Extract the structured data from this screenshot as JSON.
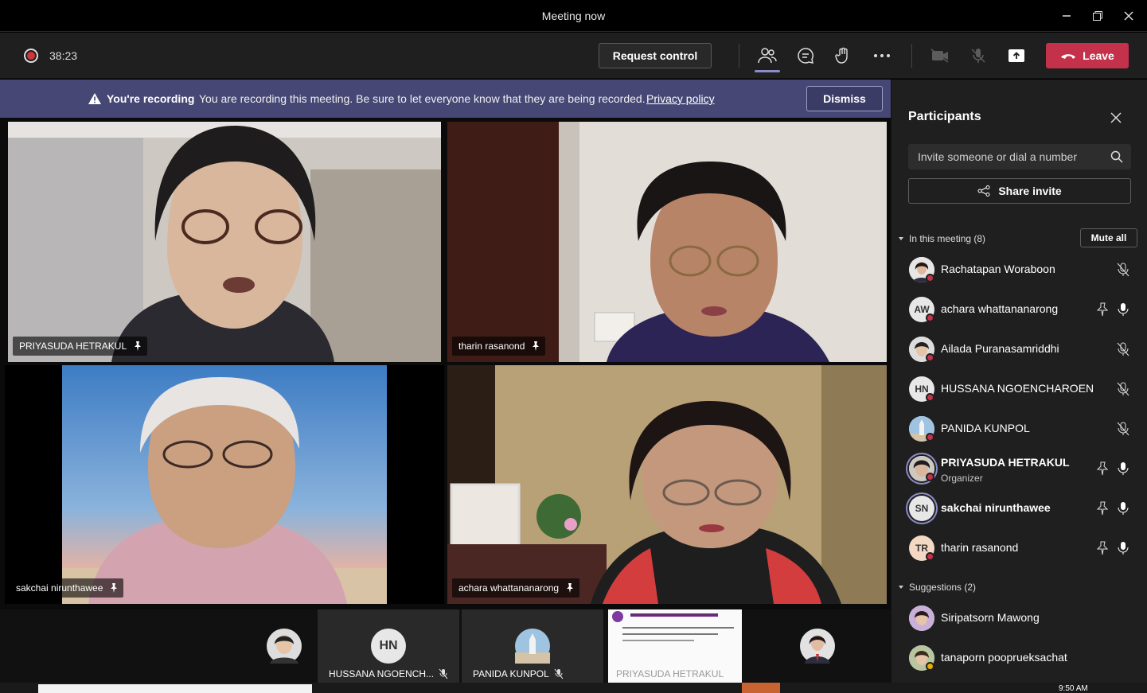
{
  "window": {
    "title": "Meeting now",
    "minimize": "—",
    "restore": "❐",
    "close": "✕"
  },
  "toolbar": {
    "timer": "38:23",
    "request_control": "Request control",
    "leave": "Leave"
  },
  "banner": {
    "title": "You're recording",
    "message": "You are recording this meeting. Be sure to let everyone know that they are being recorded.",
    "link": "Privacy policy",
    "dismiss": "Dismiss"
  },
  "stage": {
    "tiles": [
      {
        "name": "PRIYASUDA HETRAKUL"
      },
      {
        "name": "tharin rasanond"
      },
      {
        "name": "sakchai nirunthawee"
      },
      {
        "name": "achara whattananarong"
      }
    ],
    "bottom": [
      {
        "name": ""
      },
      {
        "initials": "HN",
        "name": "HUSSANA NGOENCH..."
      },
      {
        "name": "PANIDA KUNPOL"
      },
      {
        "name": "PRIYASUDA HETRAKUL"
      },
      {
        "name": ""
      }
    ]
  },
  "panel": {
    "title": "Participants",
    "search_placeholder": "Invite someone or dial a number",
    "share_invite": "Share invite",
    "in_meeting": "In this meeting (8)",
    "mute_all": "Mute all",
    "participants": [
      {
        "name": "Rachatapan Woraboon",
        "role": ""
      },
      {
        "initials": "AW",
        "name": "achara whattananarong",
        "role": ""
      },
      {
        "name": "Ailada Puranasamriddhi",
        "role": ""
      },
      {
        "initials": "HN",
        "name": "HUSSANA NGOENCHAROEN",
        "role": ""
      },
      {
        "name": "PANIDA KUNPOL",
        "role": ""
      },
      {
        "name": "PRIYASUDA HETRAKUL",
        "role": "Organizer"
      },
      {
        "initials": "SN",
        "name": "sakchai nirunthawee",
        "role": ""
      },
      {
        "initials": "TR",
        "name": "tharin rasanond",
        "role": ""
      }
    ],
    "suggestions": "Suggestions (2)",
    "suggested": [
      {
        "name": "Siripatsorn Mawong"
      },
      {
        "name": "tanaporn pooprueksachat"
      }
    ]
  },
  "taskbar": {
    "time": "9:50 AM"
  },
  "colors": {
    "leave": "#c4314b",
    "banner": "#464775",
    "accent": "#8b8cc7"
  }
}
